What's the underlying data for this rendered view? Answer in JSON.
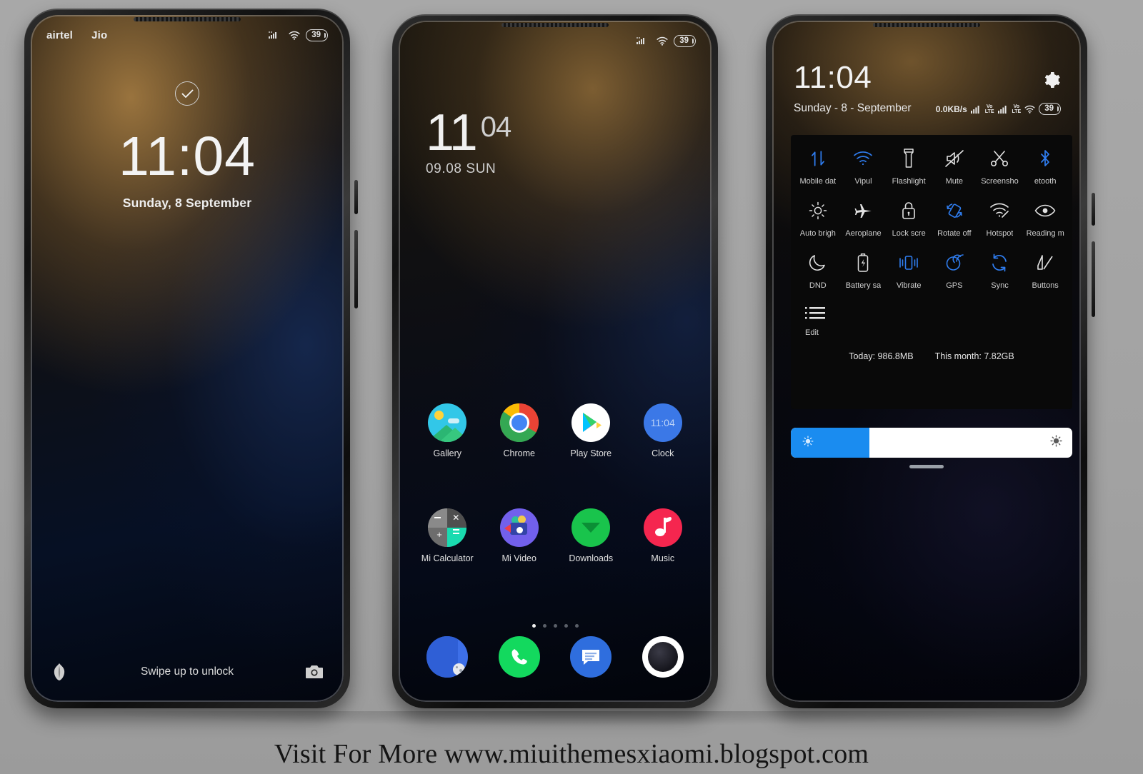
{
  "lock_screen": {
    "status_bar": {
      "carrier1": "airtel",
      "carrier2": "Jio",
      "battery": "39",
      "signal_icon": "signal-bars-icon",
      "wifi_icon": "wifi-icon"
    },
    "check_icon": "check-circle-icon",
    "time": "11:04",
    "date": "Sunday, 8 September",
    "hint": "Swipe up to unlock",
    "left_shortcut_icon": "flower-icon",
    "right_shortcut_icon": "camera-icon"
  },
  "home_screen": {
    "status_bar": {
      "battery": "39",
      "signal_icon": "signal-bars-icon",
      "wifi_icon": "wifi-icon"
    },
    "widget": {
      "hour": "11",
      "minute": "04",
      "date": "09.08 SUN"
    },
    "apps_row1": [
      {
        "label": "Gallery",
        "icon": "gallery-icon"
      },
      {
        "label": "Chrome",
        "icon": "chrome-icon"
      },
      {
        "label": "Play Store",
        "icon": "play-store-icon"
      },
      {
        "label": "Clock",
        "icon": "clock-icon",
        "badge": "11:04"
      }
    ],
    "apps_row2": [
      {
        "label": "Mi Calculator",
        "icon": "calculator-icon"
      },
      {
        "label": "Mi Video",
        "icon": "video-icon"
      },
      {
        "label": "Downloads",
        "icon": "downloads-icon"
      },
      {
        "label": "Music",
        "icon": "music-icon"
      }
    ],
    "dock": [
      {
        "label": "",
        "icon": "browser-icon"
      },
      {
        "label": "",
        "icon": "phone-icon"
      },
      {
        "label": "",
        "icon": "messages-icon"
      },
      {
        "label": "",
        "icon": "camera-app-icon"
      }
    ],
    "page_count": 5,
    "active_page": 1
  },
  "notification_panel": {
    "time": "11:04",
    "date": "Sunday - 8 - September",
    "net_speed": "0.0KB/s",
    "volte_label": "Vo\nLTE",
    "battery": "39",
    "settings_icon": "gear-icon",
    "toggles": [
      {
        "label": "Mobile dat",
        "icon": "mobile-data-icon",
        "active": true
      },
      {
        "label": "Vipul",
        "icon": "wifi-icon",
        "active": true
      },
      {
        "label": "Flashlight",
        "icon": "flashlight-icon",
        "active": false
      },
      {
        "label": "Mute",
        "icon": "mute-icon",
        "active": false
      },
      {
        "label": "Screensho",
        "icon": "scissors-icon",
        "active": false
      },
      {
        "label": "etooth",
        "icon": "bluetooth-icon",
        "active": true
      },
      {
        "label": "Auto brigh",
        "icon": "brightness-icon",
        "active": false
      },
      {
        "label": "Aeroplane",
        "icon": "airplane-icon",
        "active": false
      },
      {
        "label": "Lock scre",
        "icon": "lock-icon",
        "active": false
      },
      {
        "label": "Rotate off",
        "icon": "rotate-icon",
        "active": true
      },
      {
        "label": "Hotspot",
        "icon": "hotspot-icon",
        "active": false
      },
      {
        "label": "Reading m",
        "icon": "eye-icon",
        "active": false
      },
      {
        "label": "DND",
        "icon": "moon-icon",
        "active": false
      },
      {
        "label": "Battery sa",
        "icon": "battery-saver-icon",
        "active": false
      },
      {
        "label": "Vibrate",
        "icon": "vibrate-icon",
        "active": true
      },
      {
        "label": "GPS",
        "icon": "gps-icon",
        "active": true
      },
      {
        "label": "Sync",
        "icon": "sync-icon",
        "active": true
      },
      {
        "label": "Buttons",
        "icon": "buttons-icon",
        "active": false
      }
    ],
    "edit": {
      "label": "Edit",
      "icon": "list-icon"
    },
    "usage_today": "Today: 986.8MB",
    "usage_month": "This month: 7.82GB",
    "brightness": {
      "value_percent": 28,
      "low_icon": "brightness-low-icon",
      "high_icon": "brightness-high-icon"
    }
  },
  "footer": {
    "text": "Visit For More www.miuithemesxiaomi.blogspot.com"
  },
  "colors": {
    "accent_blue": "#1a8cf0",
    "toggle_active": "#2f7df0",
    "panel_bg": "#090909"
  }
}
